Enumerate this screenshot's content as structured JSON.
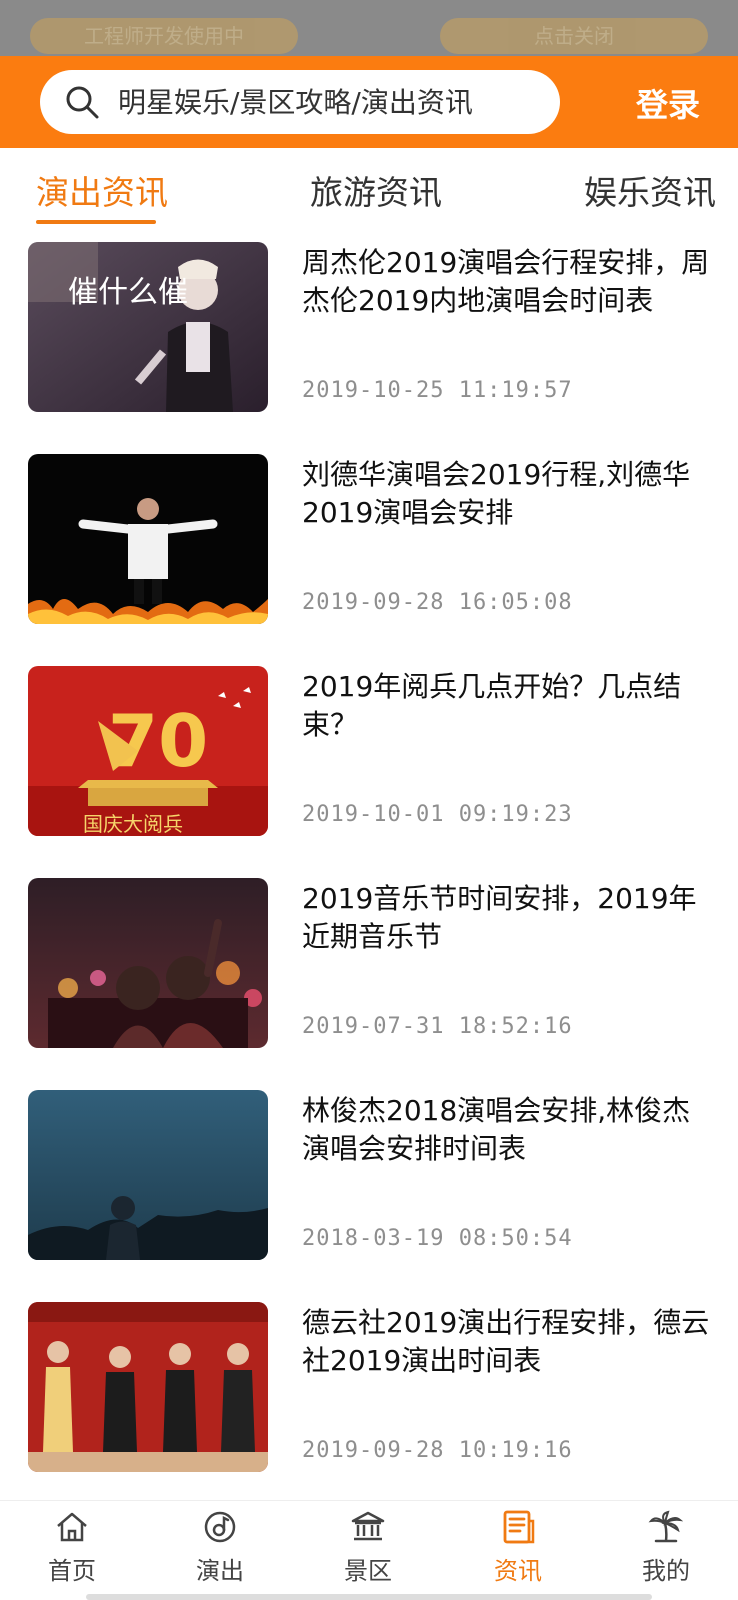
{
  "dev_banner": {
    "left_pill": "工程师开发使用中",
    "right_pill": "点击关闭"
  },
  "header": {
    "search_placeholder": "明星娱乐/景区攻略/演出资讯",
    "login_label": "登录"
  },
  "tabs": [
    {
      "label": "演出资讯",
      "active": true
    },
    {
      "label": "旅游资讯",
      "active": false
    },
    {
      "label": "娱乐资讯",
      "active": false
    }
  ],
  "articles": [
    {
      "title": "周杰伦2019演唱会行程安排，周杰伦2019内地演唱会时间表",
      "time": "2019-10-25 11:19:57",
      "thumb_text": "催什么催"
    },
    {
      "title": "刘德华演唱会2019行程,刘德华2019演唱会安排",
      "time": "2019-09-28 16:05:08",
      "thumb_text": ""
    },
    {
      "title": "2019年阅兵几点开始？几点结束？",
      "time": "2019-10-01 09:19:23",
      "thumb_text": "国庆大阅兵"
    },
    {
      "title": "2019音乐节时间安排，2019年近期音乐节",
      "time": "2019-07-31 18:52:16",
      "thumb_text": ""
    },
    {
      "title": "林俊杰2018演唱会安排,林俊杰演唱会安排时间表",
      "time": "2018-03-19 08:50:54",
      "thumb_text": ""
    },
    {
      "title": "德云社2019演出行程安排，德云社2019演出时间表",
      "time": "2019-09-28 10:19:16",
      "thumb_text": ""
    }
  ],
  "bottom_nav": [
    {
      "label": "首页",
      "icon": "home-icon",
      "active": false
    },
    {
      "label": "演出",
      "icon": "music-disc-icon",
      "active": false
    },
    {
      "label": "景区",
      "icon": "museum-icon",
      "active": false
    },
    {
      "label": "资讯",
      "icon": "news-icon",
      "active": true
    },
    {
      "label": "我的",
      "icon": "palm-tree-icon",
      "active": false
    }
  ],
  "colors": {
    "accent": "#fb7c10",
    "active_text": "#f07a12"
  }
}
